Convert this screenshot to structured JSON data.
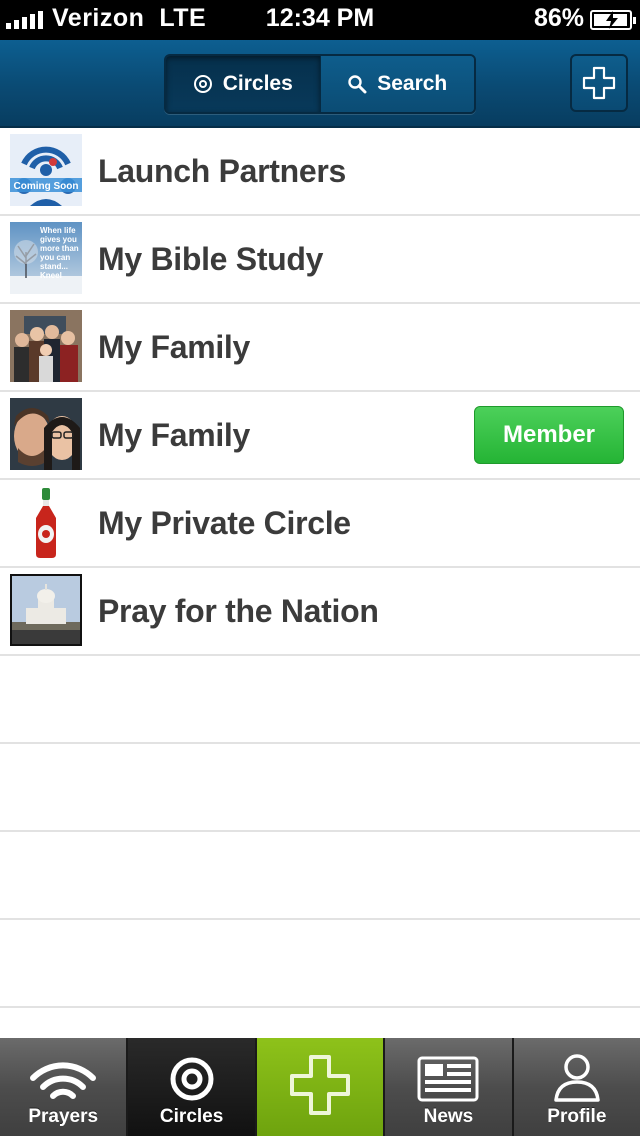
{
  "status_bar": {
    "carrier": "Verizon",
    "network": "LTE",
    "time": "12:34 PM",
    "battery": "86%"
  },
  "nav": {
    "segments": [
      {
        "label": "Circles",
        "icon": "target-icon",
        "selected": true
      },
      {
        "label": "Search",
        "icon": "search-icon",
        "selected": false
      }
    ],
    "add_icon": "plus-icon"
  },
  "circles": [
    {
      "name": "Launch Partners",
      "thumb": "coming-soon-logo"
    },
    {
      "name": "My Bible Study",
      "thumb": "winter-tree-quote"
    },
    {
      "name": "My Family",
      "thumb": "family-group-photo"
    },
    {
      "name": "My Family",
      "thumb": "couple-selfie-photo",
      "badge": "Member"
    },
    {
      "name": "My Private Circle",
      "thumb": "sriracha-bottle"
    },
    {
      "name": "Pray for the Nation",
      "thumb": "capitol-building"
    }
  ],
  "thumb_text": {
    "coming_soon": "Coming Soon",
    "quote": "When life gives you more than you can stand... Kneel"
  },
  "tabs": [
    {
      "label": "Prayers",
      "icon": "wifi-waves-icon"
    },
    {
      "label": "Circles",
      "icon": "target-icon",
      "selected": true
    },
    {
      "label": "",
      "icon": "plus-icon"
    },
    {
      "label": "News",
      "icon": "newspaper-icon"
    },
    {
      "label": "Profile",
      "icon": "person-icon"
    }
  ],
  "colors": {
    "nav_blue": "#0a4a73",
    "member_green": "#25b435",
    "center_tab_green": "#7ab412"
  }
}
